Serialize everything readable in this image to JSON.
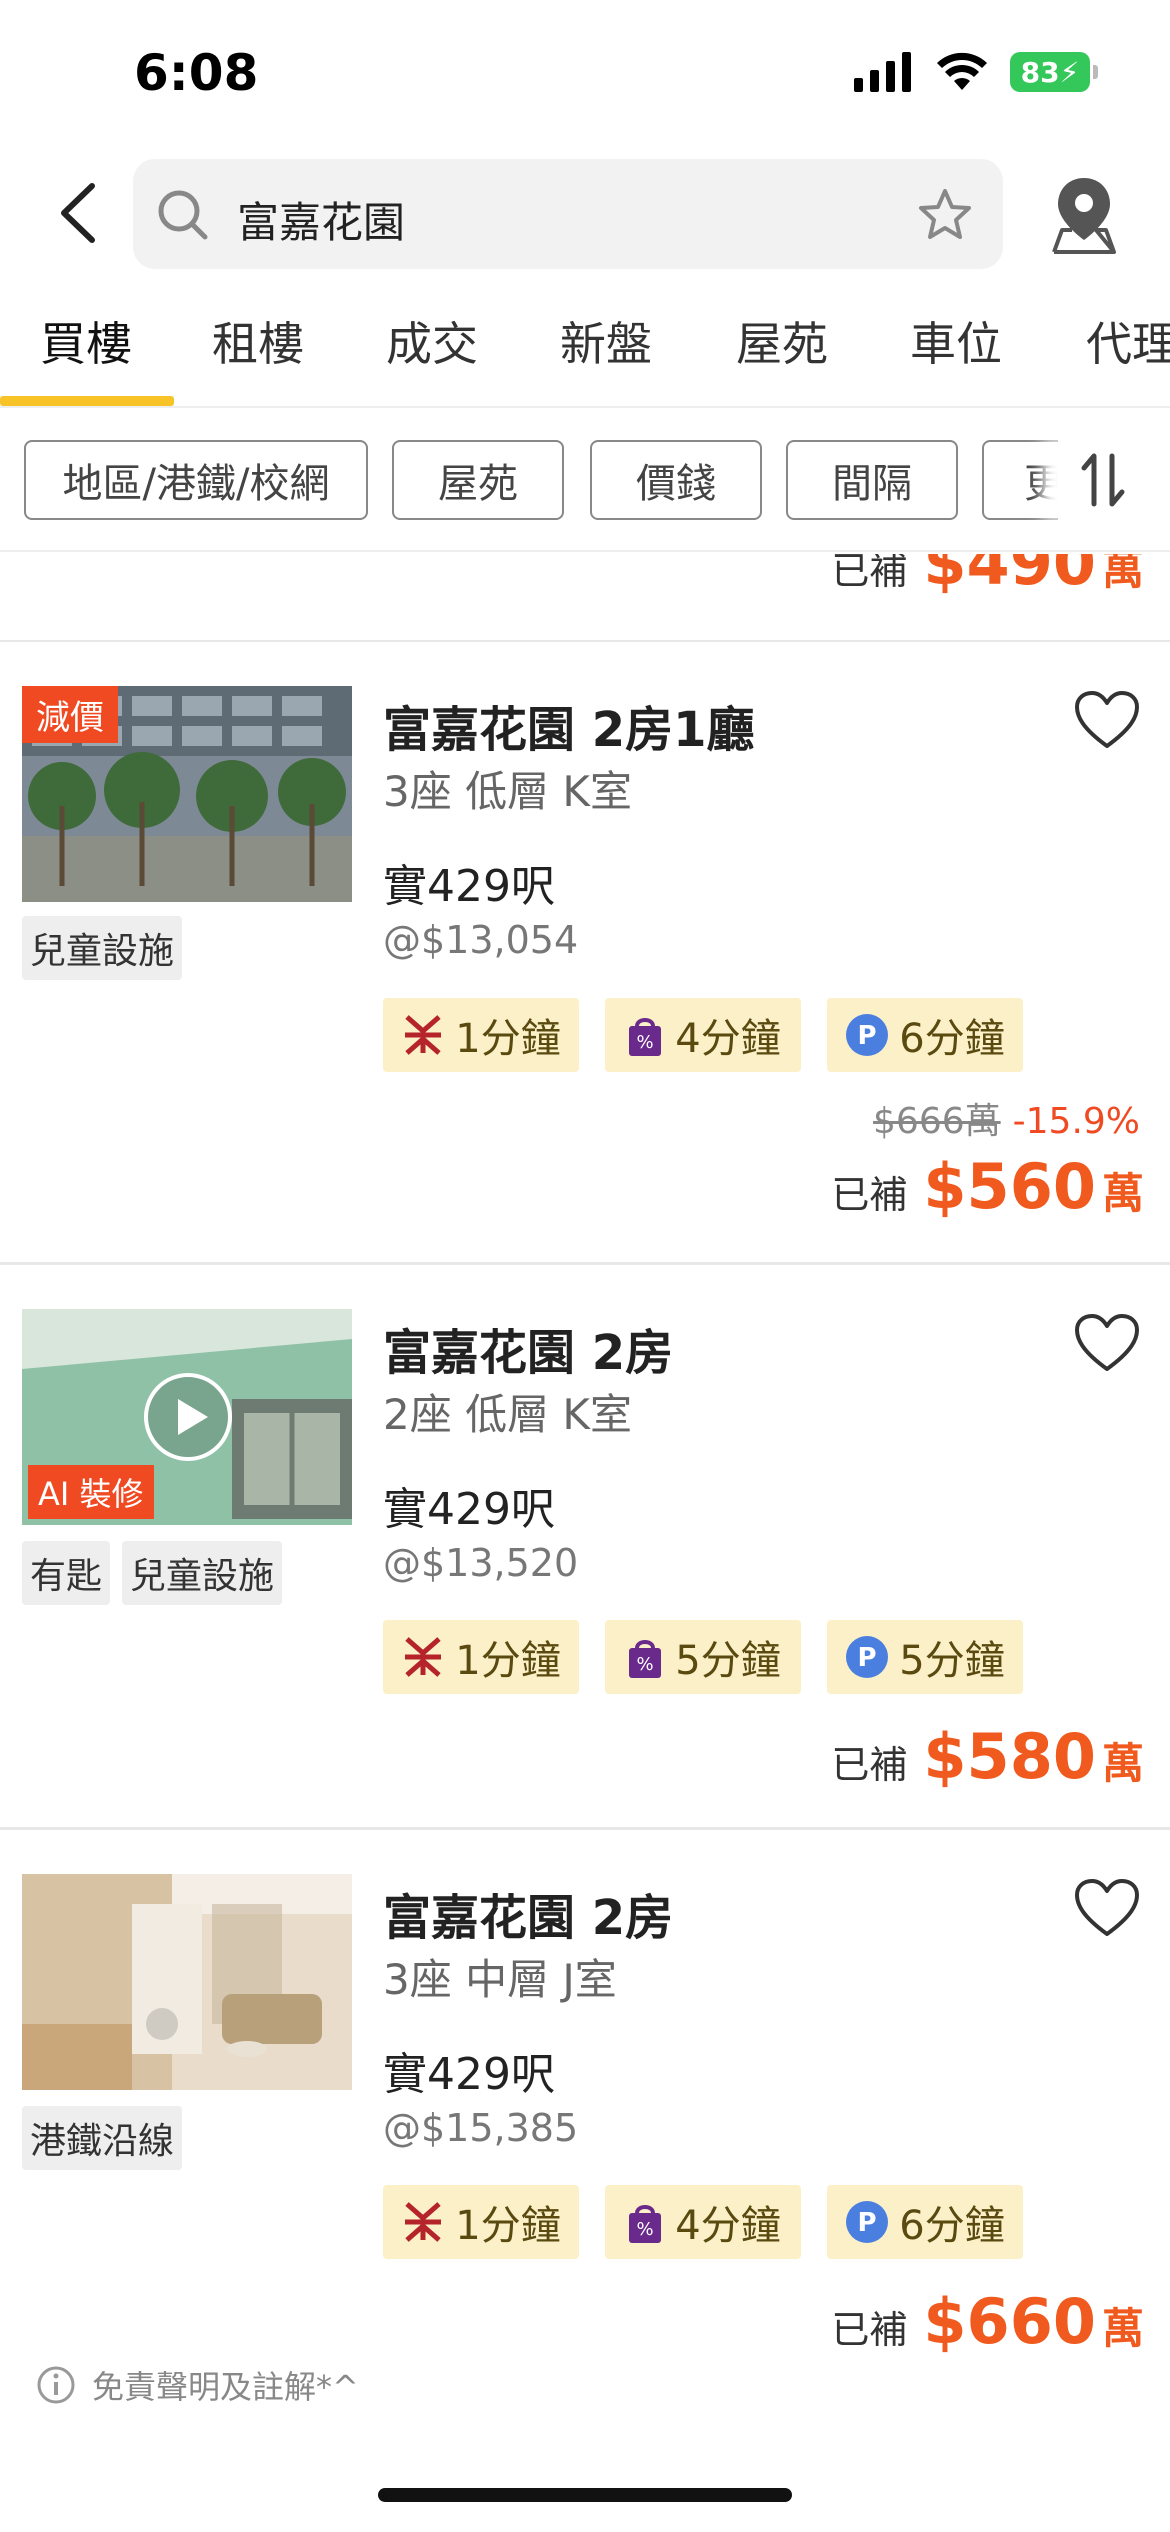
{
  "status_bar": {
    "time": "6:08",
    "battery": "83"
  },
  "search": {
    "query": "富嘉花園"
  },
  "tabs": [
    {
      "label": "買樓",
      "active": true
    },
    {
      "label": "租樓"
    },
    {
      "label": "成交"
    },
    {
      "label": "新盤"
    },
    {
      "label": "屋苑"
    },
    {
      "label": "車位"
    },
    {
      "label": "代理"
    }
  ],
  "filters": [
    "地區/港鐵/校網",
    "屋苑",
    "價錢",
    "間隔",
    "更"
  ],
  "previous_card": {
    "price_label": "已補",
    "price": "$490",
    "price_unit": "萬"
  },
  "listings": [
    {
      "title": "富嘉花園 2房1廳",
      "subtitle": "3座 低層 K室",
      "badge": "減價",
      "tags": [
        "兒童設施"
      ],
      "area": "實429呎",
      "unit_price": "@$13,054",
      "chips": [
        {
          "icon": "mtr-icon",
          "text": "1分鐘"
        },
        {
          "icon": "shopping-bag-icon",
          "text": "4分鐘"
        },
        {
          "icon": "parking-icon",
          "text": "6分鐘"
        }
      ],
      "original_price": "$666萬",
      "discount": "-15.9%",
      "price_label": "已補",
      "price": "$560",
      "price_unit": "萬"
    },
    {
      "title": "富嘉花園 2房",
      "subtitle": "2座 低層 K室",
      "badge": "AI 裝修",
      "tags": [
        "有匙",
        "兒童設施"
      ],
      "area": "實429呎",
      "unit_price": "@$13,520",
      "chips": [
        {
          "icon": "mtr-icon",
          "text": "1分鐘"
        },
        {
          "icon": "shopping-bag-icon",
          "text": "5分鐘"
        },
        {
          "icon": "parking-icon",
          "text": "5分鐘"
        }
      ],
      "price_label": "已補",
      "price": "$580",
      "price_unit": "萬"
    },
    {
      "title": "富嘉花園 2房",
      "subtitle": "3座 中層 J室",
      "tags": [
        "港鐵沿線"
      ],
      "area": "實429呎",
      "unit_price": "@$15,385",
      "chips": [
        {
          "icon": "mtr-icon",
          "text": "1分鐘"
        },
        {
          "icon": "shopping-bag-icon",
          "text": "4分鐘"
        },
        {
          "icon": "parking-icon",
          "text": "6分鐘"
        }
      ],
      "price_label": "已補",
      "price": "$660",
      "price_unit": "萬"
    }
  ],
  "disclaimer": "免責聲明及註解*^",
  "colors": {
    "accent": "#f7c326",
    "price": "#f05a1e",
    "badge": "#f04a23",
    "chip_bg": "#fbf0c8"
  }
}
